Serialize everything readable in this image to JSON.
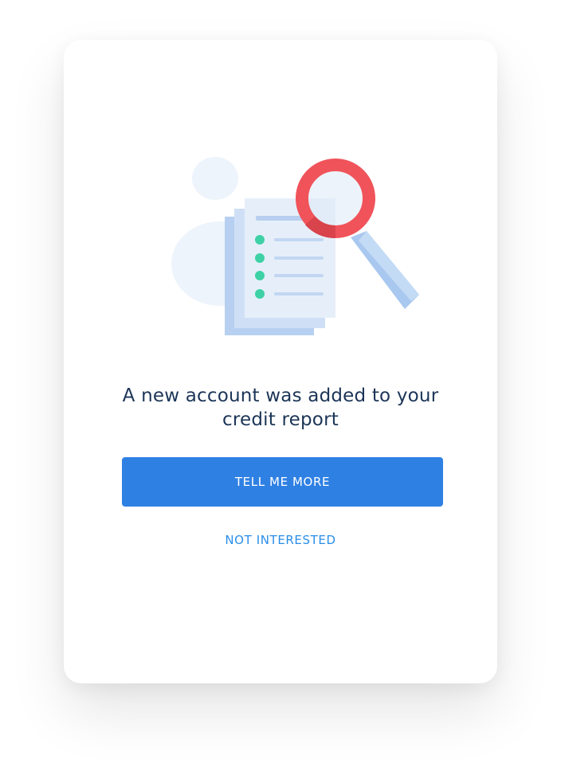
{
  "card": {
    "illustration_icon": "document-magnifier-illustration",
    "headline": "A new account was added to your credit report",
    "primary_button_label": "TELL ME MORE",
    "secondary_button_label": "NOT INTERESTED"
  },
  "colors": {
    "headline": "#1c3557",
    "primary_button": "#2f80e3",
    "link": "#2a8ee8",
    "magnifier_ring": "#f0535a",
    "checklist_dot": "#3fd1a6",
    "document": "#c7dbf4"
  }
}
